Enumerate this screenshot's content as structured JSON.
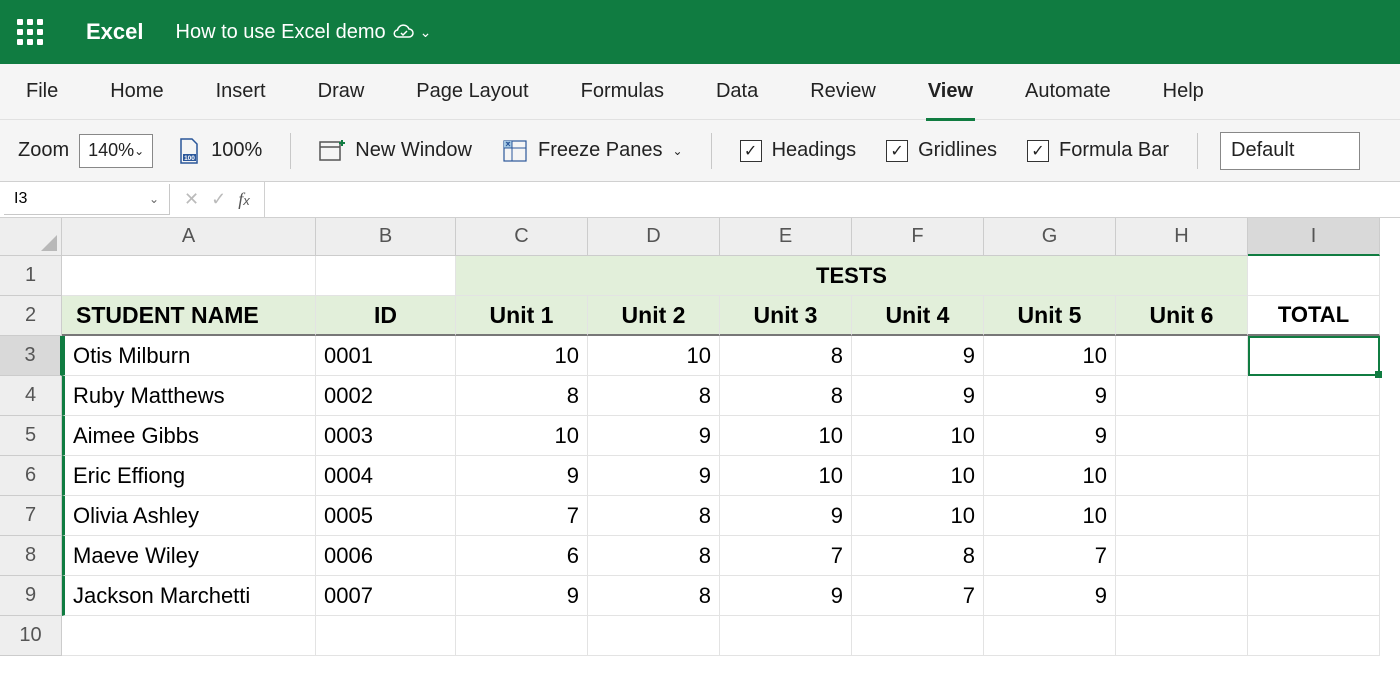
{
  "titlebar": {
    "app_name": "Excel",
    "doc_name": "How to use Excel demo"
  },
  "ribbon": {
    "tabs": [
      "File",
      "Home",
      "Insert",
      "Draw",
      "Page Layout",
      "Formulas",
      "Data",
      "Review",
      "View",
      "Automate",
      "Help"
    ],
    "active_tab": "View",
    "toolbar": {
      "zoom_label": "Zoom",
      "zoom_value": "140%",
      "zoom_100_label": "100%",
      "new_window_label": "New Window",
      "freeze_panes_label": "Freeze Panes",
      "headings_label": "Headings",
      "gridlines_label": "Gridlines",
      "formula_bar_label": "Formula Bar",
      "view_mode": "Default"
    }
  },
  "formula_bar": {
    "name_box": "I3",
    "formula": ""
  },
  "sheet": {
    "columns": [
      "A",
      "B",
      "C",
      "D",
      "E",
      "F",
      "G",
      "H",
      "I"
    ],
    "rows": [
      "1",
      "2",
      "3",
      "4",
      "5",
      "6",
      "7",
      "8",
      "9",
      "10"
    ],
    "selected_cell": "I3",
    "tests_header": "TESTS",
    "header_labels": {
      "student_name": "STUDENT NAME",
      "id": "ID",
      "unit1": "Unit 1",
      "unit2": "Unit 2",
      "unit3": "Unit 3",
      "unit4": "Unit 4",
      "unit5": "Unit 5",
      "unit6": "Unit 6",
      "total": "TOTAL"
    },
    "students": [
      {
        "name": "Otis Milburn",
        "id": "0001",
        "u1": "10",
        "u2": "10",
        "u3": "8",
        "u4": "9",
        "u5": "10",
        "u6": "",
        "total": ""
      },
      {
        "name": "Ruby Matthews",
        "id": "0002",
        "u1": "8",
        "u2": "8",
        "u3": "8",
        "u4": "9",
        "u5": "9",
        "u6": "",
        "total": ""
      },
      {
        "name": "Aimee Gibbs",
        "id": "0003",
        "u1": "10",
        "u2": "9",
        "u3": "10",
        "u4": "10",
        "u5": "9",
        "u6": "",
        "total": ""
      },
      {
        "name": "Eric Effiong",
        "id": "0004",
        "u1": "9",
        "u2": "9",
        "u3": "10",
        "u4": "10",
        "u5": "10",
        "u6": "",
        "total": ""
      },
      {
        "name": "Olivia Ashley",
        "id": "0005",
        "u1": "7",
        "u2": "8",
        "u3": "9",
        "u4": "10",
        "u5": "10",
        "u6": "",
        "total": ""
      },
      {
        "name": "Maeve Wiley",
        "id": "0006",
        "u1": "6",
        "u2": "8",
        "u3": "7",
        "u4": "8",
        "u5": "7",
        "u6": "",
        "total": ""
      },
      {
        "name": "Jackson Marchetti",
        "id": "0007",
        "u1": "9",
        "u2": "8",
        "u3": "9",
        "u4": "7",
        "u5": "9",
        "u6": "",
        "total": ""
      }
    ]
  }
}
